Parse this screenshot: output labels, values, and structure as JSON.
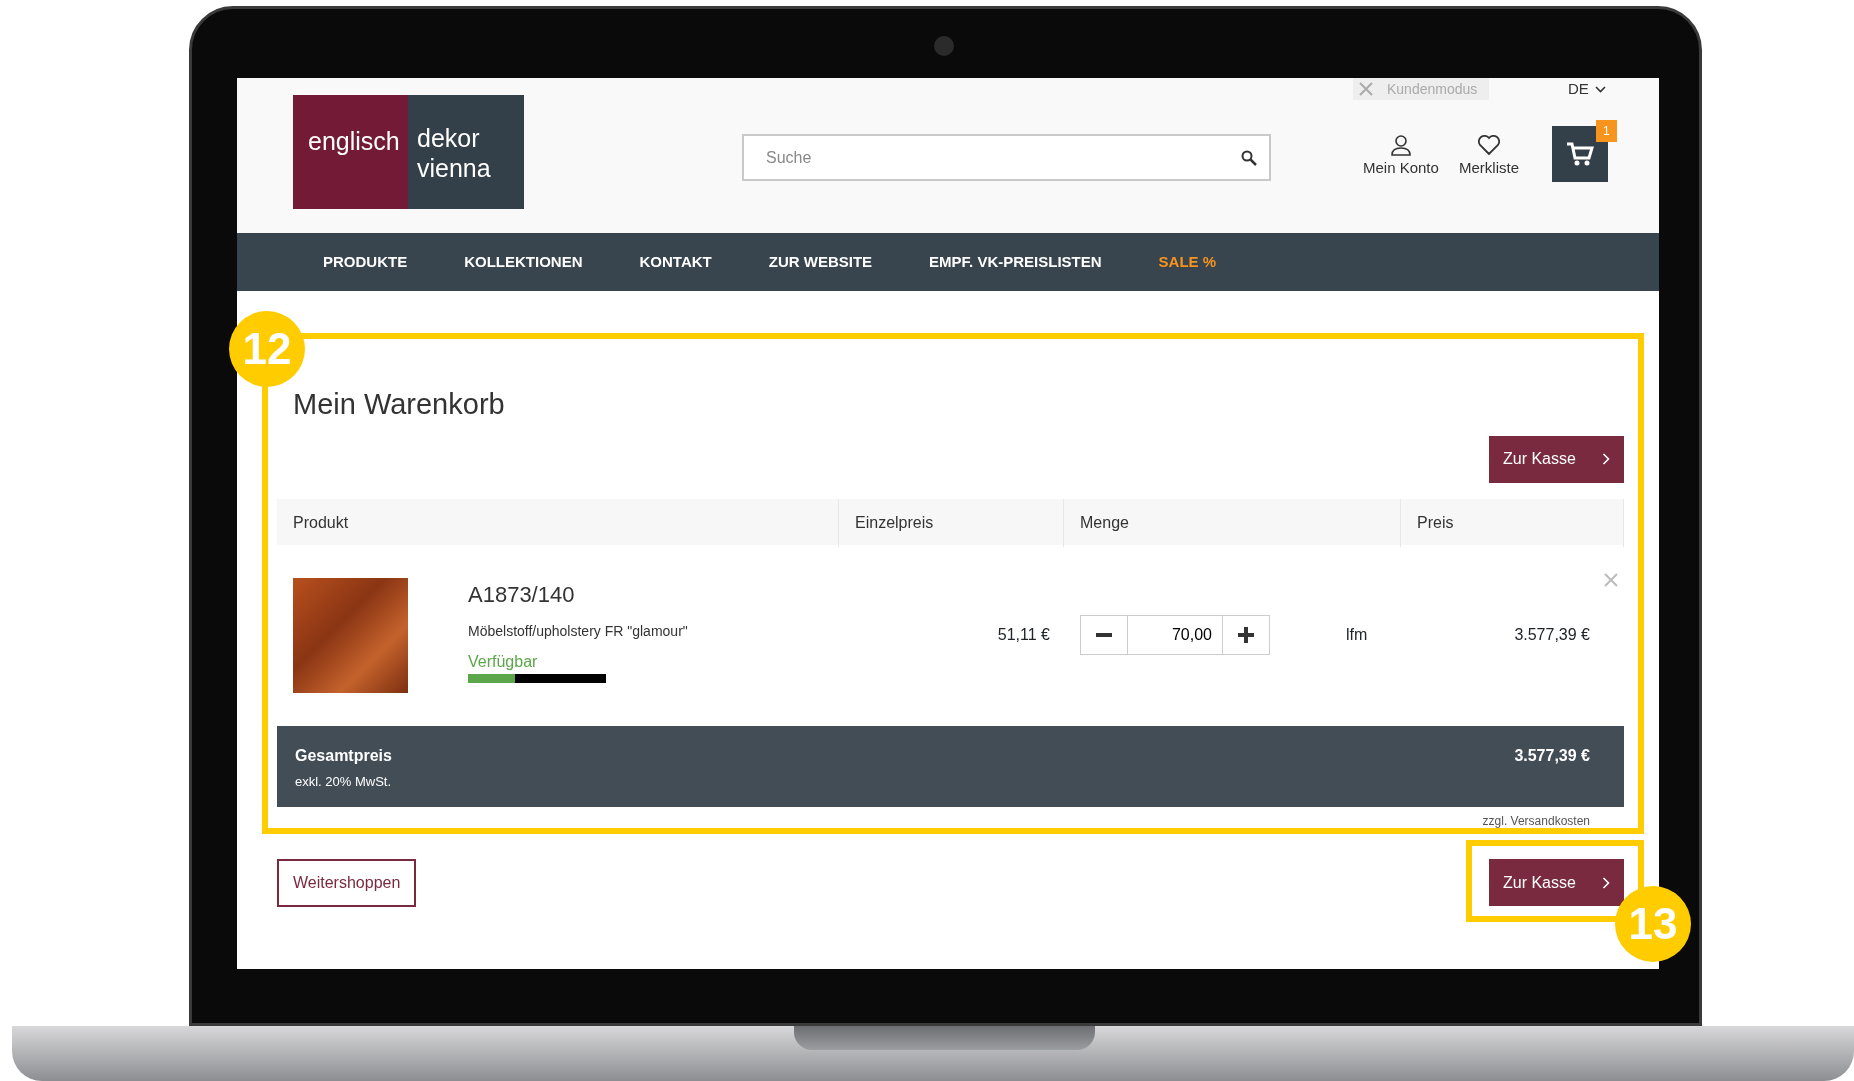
{
  "top_bar": {
    "customer_mode": "Kundenmodus",
    "language": "DE"
  },
  "logo": {
    "left": "englisch",
    "right_top": "dekor",
    "right_bottom": "vienna"
  },
  "search": {
    "placeholder": "Suche"
  },
  "header_links": [
    {
      "label": "Mein Konto",
      "kind": "account"
    },
    {
      "label": "Merkliste",
      "kind": "wishlist"
    }
  ],
  "cart": {
    "count": "1"
  },
  "nav": [
    {
      "label": "PRODUKTE",
      "kind": "normal"
    },
    {
      "label": "KOLLEKTIONEN",
      "kind": "normal"
    },
    {
      "label": "KONTAKT",
      "kind": "normal"
    },
    {
      "label": "ZUR WEBSITE",
      "kind": "normal"
    },
    {
      "label": "EMPF. VK-PREISLISTEN",
      "kind": "normal"
    },
    {
      "label": "SALE %",
      "kind": "sale"
    }
  ],
  "cart_page": {
    "title": "Mein Warenkorb",
    "checkout_button": "Zur Kasse",
    "columns": [
      "Produkt",
      "Einzelpreis",
      "Menge",
      "Preis"
    ],
    "items": [
      {
        "sku": "A1873/140",
        "description": "Möbelstoff/upholstery FR \"glamour\"",
        "availability": "Verfügbar",
        "level": 0.34,
        "unit_price": "51,11 €",
        "quantity": "70,00",
        "unit": "lfm",
        "price": "3.577,39 €"
      }
    ],
    "total": {
      "label": "Gesamtpreis",
      "note": "exkl. 20% MwSt.",
      "value": "3.577,39 €"
    },
    "shipping_note": "zzgl. Versandkosten",
    "continue_button": "Weitershoppen",
    "checkout_button_bottom": "Zur Kasse"
  },
  "annotations": [
    {
      "number": "12"
    },
    {
      "number": "13"
    }
  ]
}
